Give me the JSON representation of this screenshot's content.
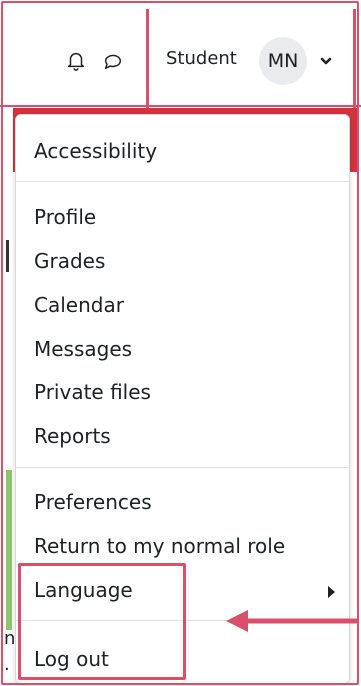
{
  "header": {
    "role_label": "Student",
    "avatar_initials": "MN",
    "icons": [
      "bell-icon",
      "chat-bubble-icon",
      "chevron-down-icon"
    ]
  },
  "user_menu": {
    "items": [
      {
        "label": "Accessibility"
      },
      {
        "label": "Profile"
      },
      {
        "label": "Grades"
      },
      {
        "label": "Calendar"
      },
      {
        "label": "Messages"
      },
      {
        "label": "Private files"
      },
      {
        "label": "Reports"
      },
      {
        "label": "Preferences"
      },
      {
        "label": "Return to my normal role"
      },
      {
        "label": "Language"
      },
      {
        "label": "Log out"
      }
    ],
    "language_submenu_icon": "caret-right-icon"
  },
  "background_fragments": {
    "line1": "n",
    "line2": "."
  },
  "colors": {
    "annotation": "#d94f6c",
    "brand_red": "#d4323f",
    "avatar_bg": "#e9ebee",
    "side_green": "#8cc56b"
  }
}
